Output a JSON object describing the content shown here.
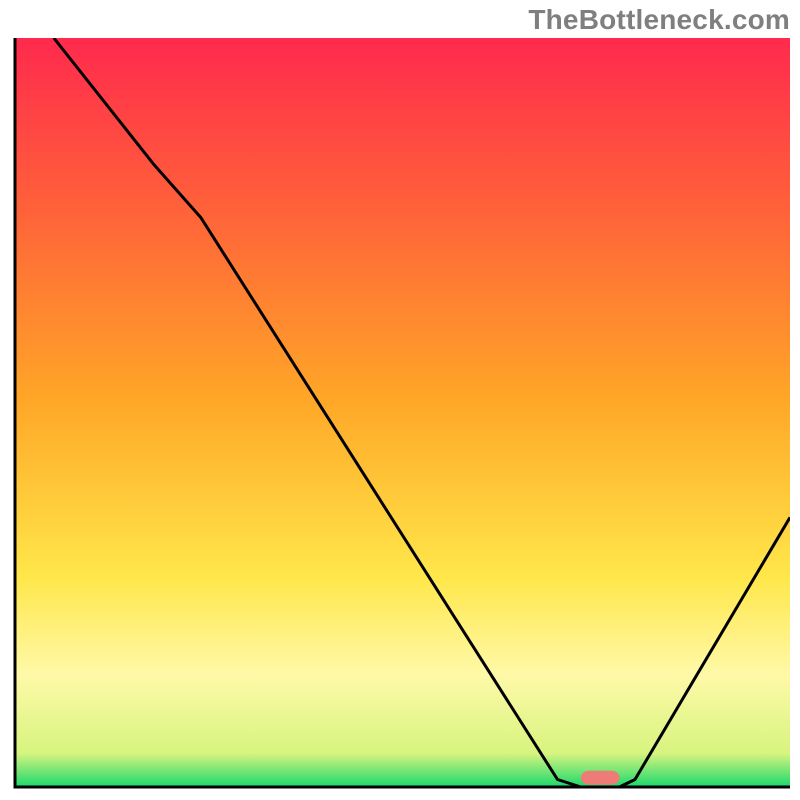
{
  "watermark": "TheBottleneck.com",
  "colors": {
    "gradient_top": "#ff2a4d",
    "gradient_mid_top": "#ff5a3c",
    "gradient_mid": "#ffa627",
    "gradient_mid_low": "#ffe74a",
    "gradient_pale": "#fff9a8",
    "gradient_green": "#1bd96c",
    "axis": "#000000",
    "curve": "#000000",
    "marker": "#ef7b77"
  },
  "chart_data": {
    "type": "line",
    "title": "",
    "xlabel": "",
    "ylabel": "",
    "xlim": [
      0,
      100
    ],
    "ylim": [
      0,
      100
    ],
    "grid": false,
    "legend": false,
    "series": [
      {
        "name": "bottleneck-curve",
        "x": [
          5,
          18,
          24,
          70,
          73,
          78,
          80,
          100
        ],
        "y": [
          100,
          83,
          76,
          1,
          0,
          0,
          1,
          36
        ]
      }
    ],
    "marker": {
      "name": "optimal-range",
      "x_start": 73,
      "x_end": 78,
      "y": 0.3,
      "shape": "capsule"
    },
    "background_gradient_stops": [
      {
        "offset": 0.0,
        "color": "#ff2a4d"
      },
      {
        "offset": 0.2,
        "color": "#ff5a3c"
      },
      {
        "offset": 0.48,
        "color": "#ffa627"
      },
      {
        "offset": 0.72,
        "color": "#ffe74a"
      },
      {
        "offset": 0.85,
        "color": "#fff9a8"
      },
      {
        "offset": 0.955,
        "color": "#d7f47f"
      },
      {
        "offset": 1.0,
        "color": "#1bd96c"
      }
    ]
  }
}
